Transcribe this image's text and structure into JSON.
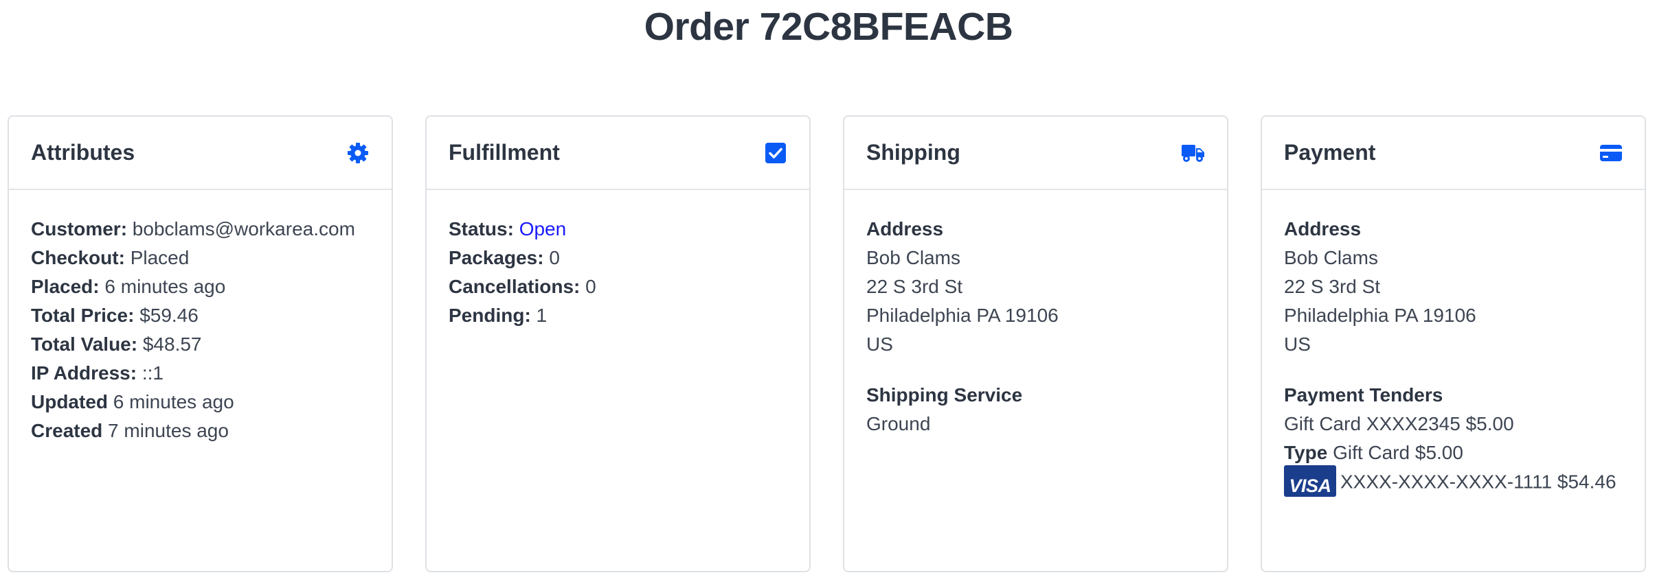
{
  "page": {
    "title": "Order 72C8BFEACB"
  },
  "attributes": {
    "title": "Attributes",
    "icon": "gear-icon",
    "rows": [
      {
        "label": "Customer:",
        "value": "bobclams@workarea.com"
      },
      {
        "label": "Checkout:",
        "value": "Placed"
      },
      {
        "label": "Placed:",
        "value": "6 minutes ago"
      },
      {
        "label": "Total Price:",
        "value": "$59.46"
      },
      {
        "label": "Total Value:",
        "value": "$48.57"
      },
      {
        "label": "IP Address:",
        "value": "::1"
      },
      {
        "label": "Updated",
        "value": "6 minutes ago"
      },
      {
        "label": "Created",
        "value": "7 minutes ago"
      }
    ]
  },
  "fulfillment": {
    "title": "Fulfillment",
    "icon": "checkbox-checked-icon",
    "rows": [
      {
        "label": "Status:",
        "value": "Open"
      },
      {
        "label": "Packages:",
        "value": "0"
      },
      {
        "label": "Cancellations:",
        "value": "0"
      },
      {
        "label": "Pending:",
        "value": "1"
      }
    ]
  },
  "shipping": {
    "title": "Shipping",
    "icon": "truck-icon",
    "address_heading": "Address",
    "address_lines": [
      "Bob Clams",
      "22 S 3rd St",
      "Philadelphia PA 19106",
      "US"
    ],
    "service_heading": "Shipping Service",
    "service": "Ground"
  },
  "payment": {
    "title": "Payment",
    "icon": "credit-card-icon",
    "address_heading": "Address",
    "address_lines": [
      "Bob Clams",
      "22 S 3rd St",
      "Philadelphia PA 19106",
      "US"
    ],
    "tenders_heading": "Payment Tenders",
    "gift_card_line": "Gift Card XXXX2345 $5.00",
    "type_label": "Type",
    "type_value": "Gift Card $5.00",
    "card_brand": "VISA",
    "card_line": "XXXX-XXXX-XXXX-1111 $54.46"
  },
  "colors": {
    "accent": "#0a5bf5",
    "link": "#1a1aff",
    "text": "#2d3542",
    "border": "#dfe1e5",
    "visa_blue": "#1a3d8c"
  }
}
